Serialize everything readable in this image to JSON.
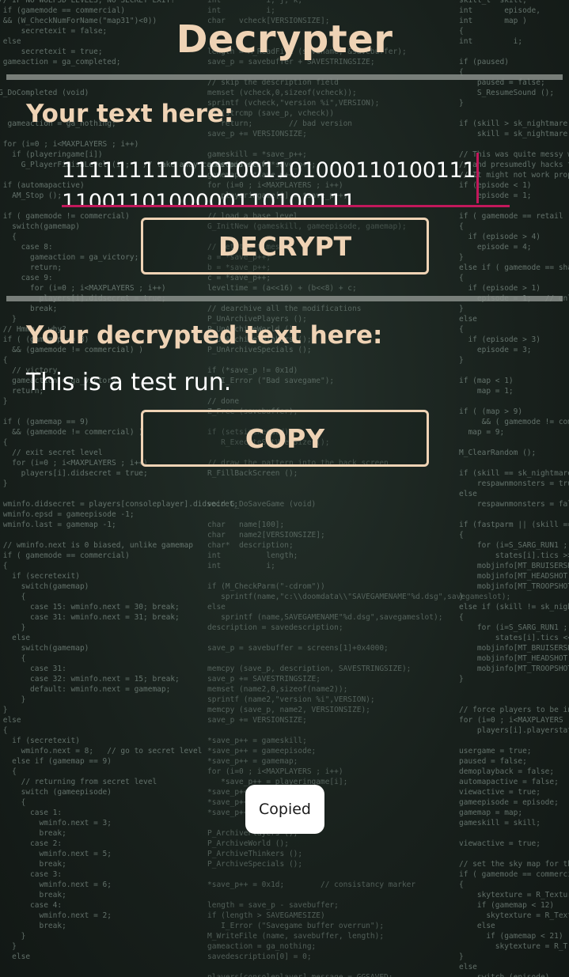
{
  "app": {
    "title": "Decrypter",
    "input_label": "Your text here:",
    "input_value": "11111111101010011010001101001111100110100000110100111",
    "decrypt_button": "DECRYPT",
    "output_label": "Your decrypted text here:",
    "output_value": "This is a test run.",
    "copy_button": "COPY",
    "toast": "Copied"
  },
  "colors": {
    "accent": "#efd3b5",
    "text": "#ffffff",
    "cursor": "#c2185b",
    "rule": "#8a8f8b",
    "background": "#1b2420",
    "toast_bg": "#ffffff"
  }
}
